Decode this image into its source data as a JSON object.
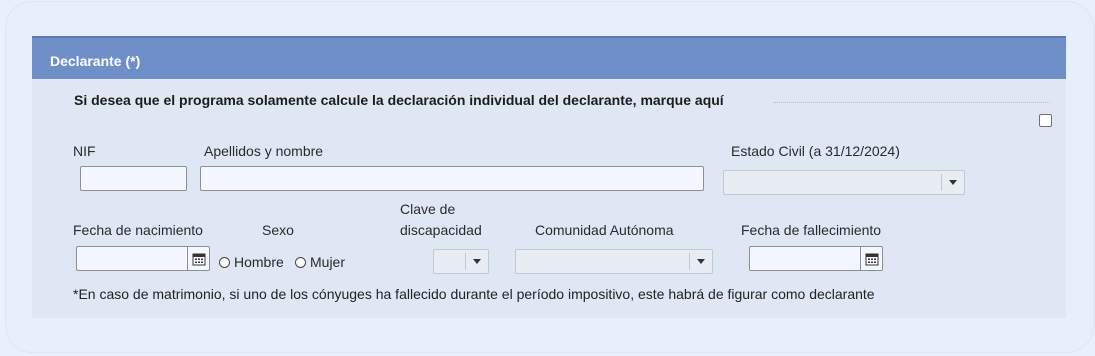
{
  "panel": {
    "title": "Declarante (*)"
  },
  "individual": {
    "instruction": "Si desea que el programa solamente calcule la declaración individual del declarante, marque aquí",
    "checked": false
  },
  "fields": {
    "nif_label": "NIF",
    "nif_value": "",
    "name_label": "Apellidos y nombre",
    "name_value": "",
    "civil_label": "Estado Civil (a 31/12/2024)",
    "civil_value": "",
    "birth_label": "Fecha de nacimiento",
    "birth_value": "",
    "sex_label": "Sexo",
    "sex_options": [
      "Hombre",
      "Mujer"
    ],
    "disability_label_line1": "Clave de",
    "disability_label_line2": "discapacidad",
    "disability_value": "",
    "community_label": "Comunidad Autónoma",
    "community_value": "",
    "death_label": "Fecha de fallecimiento",
    "death_value": ""
  },
  "note": "*En caso de matrimonio, si uno de los cónyuges ha fallecido durante el período impositivo, este habrá de figurar como declarante",
  "icons": {
    "calendar": "calendar-icon",
    "dropdown": "chevron-down-icon"
  }
}
